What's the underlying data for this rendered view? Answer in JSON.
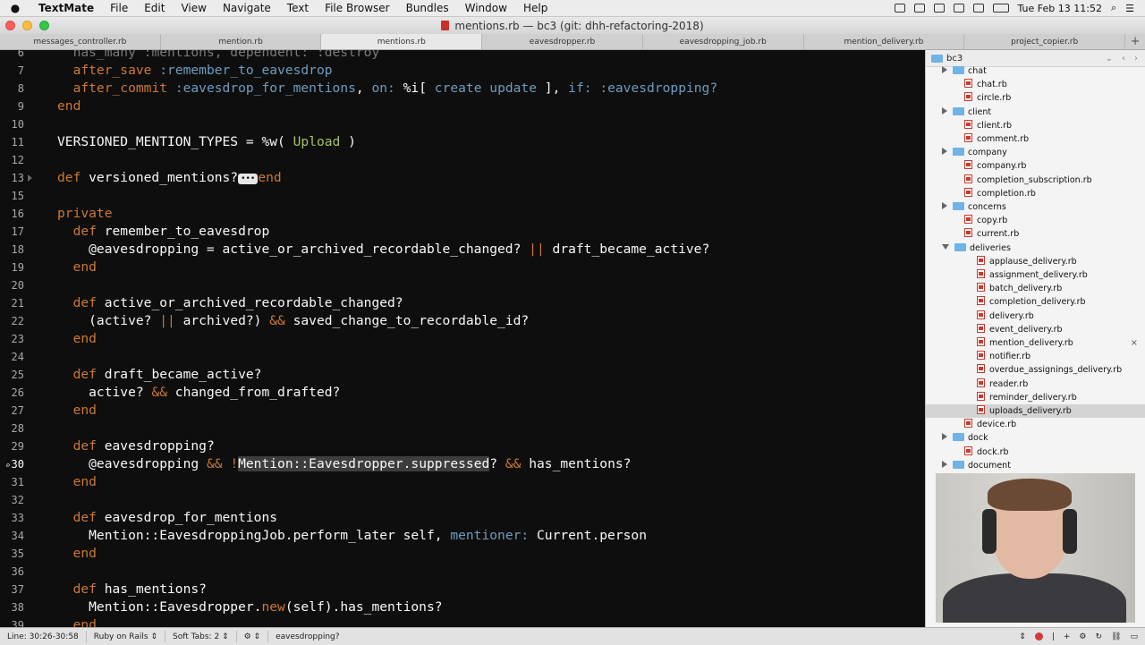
{
  "menubar": {
    "app": "TextMate",
    "items": [
      "File",
      "Edit",
      "View",
      "Navigate",
      "Text",
      "File Browser",
      "Bundles",
      "Window",
      "Help"
    ],
    "clock": "Tue Feb 13  11:52"
  },
  "window": {
    "title": "mentions.rb — bc3 (git: dhh-refactoring-2018)"
  },
  "tabs": [
    {
      "label": "messages_controller.rb",
      "active": false
    },
    {
      "label": "mention.rb",
      "active": false
    },
    {
      "label": "mentions.rb",
      "active": true
    },
    {
      "label": "eavesdropper.rb",
      "active": false
    },
    {
      "label": "eavesdropping_job.rb",
      "active": false
    },
    {
      "label": "mention_delivery.rb",
      "active": false
    },
    {
      "label": "project_copier.rb",
      "active": false
    }
  ],
  "editor": {
    "lines": [
      {
        "n": "6",
        "html": "  <span class=\"dim\">has_many :mentions, dependent: :destroy</span>"
      },
      {
        "n": "7",
        "html": "  <span class=\"kw\">after_save</span> <span class=\"sym\">:remember_to_eavesdrop</span>"
      },
      {
        "n": "8",
        "html": "  <span class=\"kw\">after_commit</span> <span class=\"sym\">:eavesdrop_for_mentions</span>, <span class=\"sym\">on:</span> %i[ <span class=\"sym\">create update</span> ], <span class=\"sym\">if:</span> <span class=\"sym\">:eavesdropping?</span>"
      },
      {
        "n": "9",
        "html": "<span class=\"kw\">end</span>"
      },
      {
        "n": "10",
        "html": ""
      },
      {
        "n": "11",
        "html": "VERSIONED_MENTION_TYPES = %w( <span class=\"str\">Upload</span> )"
      },
      {
        "n": "12",
        "html": ""
      },
      {
        "n": "13",
        "html": "<span class=\"kw\">def</span> versioned_mentions?<span class=\"fold\">•••</span><span class=\"kw\">end</span>"
      },
      {
        "n": "15",
        "html": ""
      },
      {
        "n": "16",
        "html": "<span class=\"kw\">private</span>"
      },
      {
        "n": "17",
        "html": "  <span class=\"kw\">def</span> remember_to_eavesdrop"
      },
      {
        "n": "18",
        "html": "    @eavesdropping = active_or_archived_recordable_changed? <span class=\"kw\">||</span> draft_became_active?"
      },
      {
        "n": "19",
        "html": "  <span class=\"kw\">end</span>"
      },
      {
        "n": "20",
        "html": ""
      },
      {
        "n": "21",
        "html": "  <span class=\"kw\">def</span> active_or_archived_recordable_changed?"
      },
      {
        "n": "22",
        "html": "    (active? <span class=\"kw\">||</span> archived?) <span class=\"kw\">&amp;&amp;</span> saved_change_to_recordable_id?"
      },
      {
        "n": "23",
        "html": "  <span class=\"kw\">end</span>"
      },
      {
        "n": "24",
        "html": ""
      },
      {
        "n": "25",
        "html": "  <span class=\"kw\">def</span> draft_became_active?"
      },
      {
        "n": "26",
        "html": "    active? <span class=\"kw\">&amp;&amp;</span> changed_from_drafted?"
      },
      {
        "n": "27",
        "html": "  <span class=\"kw\">end</span>"
      },
      {
        "n": "28",
        "html": ""
      },
      {
        "n": "29",
        "html": "  <span class=\"kw\">def</span> eavesdropping?"
      },
      {
        "n": "30",
        "current": true,
        "html": "    @eavesdropping <span class=\"kw\">&amp;&amp;</span> <span class=\"kw\">!</span><span class=\"sel\">Mention::Eavesdropper.suppressed</span>? <span class=\"kw\">&amp;&amp;</span> has_mentions?"
      },
      {
        "n": "31",
        "html": "  <span class=\"kw\">end</span>"
      },
      {
        "n": "32",
        "html": ""
      },
      {
        "n": "33",
        "html": "  <span class=\"kw\">def</span> eavesdrop_for_mentions"
      },
      {
        "n": "34",
        "html": "    Mention::EavesdroppingJob.perform_later self, <span class=\"sym\">mentioner:</span> Current.person"
      },
      {
        "n": "35",
        "html": "  <span class=\"kw\">end</span>"
      },
      {
        "n": "36",
        "html": ""
      },
      {
        "n": "37",
        "html": "  <span class=\"kw\">def</span> has_mentions?"
      },
      {
        "n": "38",
        "html": "    Mention::Eavesdropper.<span class=\"kw\">new</span>(self).has_mentions?"
      },
      {
        "n": "39",
        "html": "  <span class=\"kw\">end</span>"
      }
    ]
  },
  "statusbar": {
    "line": "Line:  30:26-30:58",
    "grammar": "Ruby on Rails",
    "tabs_label": "Soft Tabs:",
    "tabs_value": "2",
    "symbol": "eavesdropping?"
  },
  "file_browser": {
    "root": "bc3",
    "items": [
      {
        "label": "chat",
        "kind": "folder",
        "expand": "closed",
        "indent": 0
      },
      {
        "label": "chat.rb",
        "kind": "file",
        "indent": 0
      },
      {
        "label": "circle.rb",
        "kind": "file",
        "indent": 0
      },
      {
        "label": "client",
        "kind": "folder",
        "expand": "closed",
        "indent": 0
      },
      {
        "label": "client.rb",
        "kind": "file",
        "indent": 0
      },
      {
        "label": "comment.rb",
        "kind": "file",
        "indent": 0
      },
      {
        "label": "company",
        "kind": "folder",
        "expand": "closed",
        "indent": 0
      },
      {
        "label": "company.rb",
        "kind": "file",
        "indent": 0
      },
      {
        "label": "completion_subscription.rb",
        "kind": "file",
        "indent": 0
      },
      {
        "label": "completion.rb",
        "kind": "file",
        "indent": 0
      },
      {
        "label": "concerns",
        "kind": "folder",
        "expand": "closed",
        "indent": 0
      },
      {
        "label": "copy.rb",
        "kind": "file",
        "indent": 0
      },
      {
        "label": "current.rb",
        "kind": "file",
        "indent": 0
      },
      {
        "label": "deliveries",
        "kind": "folder",
        "expand": "open",
        "indent": 0
      },
      {
        "label": "applause_delivery.rb",
        "kind": "file",
        "indent": 1
      },
      {
        "label": "assignment_delivery.rb",
        "kind": "file",
        "indent": 1
      },
      {
        "label": "batch_delivery.rb",
        "kind": "file",
        "indent": 1
      },
      {
        "label": "completion_delivery.rb",
        "kind": "file",
        "indent": 1
      },
      {
        "label": "delivery.rb",
        "kind": "file",
        "indent": 1
      },
      {
        "label": "event_delivery.rb",
        "kind": "file",
        "indent": 1
      },
      {
        "label": "mention_delivery.rb",
        "kind": "file",
        "indent": 1,
        "close": true
      },
      {
        "label": "notifier.rb",
        "kind": "file",
        "indent": 1
      },
      {
        "label": "overdue_assignings_delivery.rb",
        "kind": "file",
        "indent": 1
      },
      {
        "label": "reader.rb",
        "kind": "file",
        "indent": 1
      },
      {
        "label": "reminder_delivery.rb",
        "kind": "file",
        "indent": 1
      },
      {
        "label": "uploads_delivery.rb",
        "kind": "file",
        "indent": 1,
        "selected": true
      },
      {
        "label": "device.rb",
        "kind": "file",
        "indent": 0
      },
      {
        "label": "dock",
        "kind": "folder",
        "expand": "closed",
        "indent": 0
      },
      {
        "label": "dock.rb",
        "kind": "file",
        "indent": 0
      },
      {
        "label": "document",
        "kind": "folder",
        "expand": "closed",
        "indent": 0
      }
    ]
  }
}
